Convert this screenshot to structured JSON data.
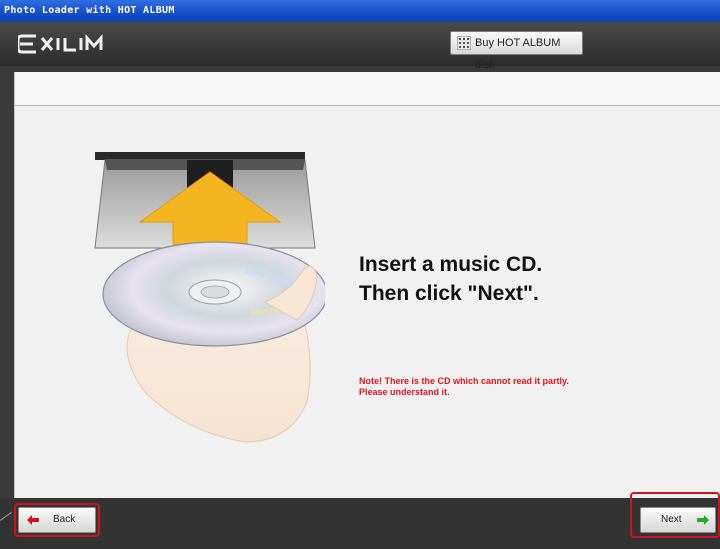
{
  "window": {
    "title": "Photo Loader with HOT ALBUM"
  },
  "header": {
    "logo_text": "EXILIM",
    "buy_button_label": "Buy HOT ALBUM disk",
    "buy_button_icon": "album-grid-icon"
  },
  "main": {
    "instruction_line1": "Insert a music CD.",
    "instruction_line2": "Then click \"Next\".",
    "note_line1": "Note! There is the CD which cannot read it partly.",
    "note_line2": "Please understand it.",
    "illustration": "insert-cd-into-drive-illustration"
  },
  "footer": {
    "back_label": "Back",
    "next_label": "Next",
    "back_icon": "arrow-left-icon",
    "next_icon": "arrow-right-icon"
  },
  "colors": {
    "titlebar": "#1550c8",
    "note_text": "#e4141c",
    "back_arrow": "#d0121a",
    "next_arrow": "#22b022",
    "highlight": "#d0121a",
    "insert_arrow": "#f5b520"
  }
}
